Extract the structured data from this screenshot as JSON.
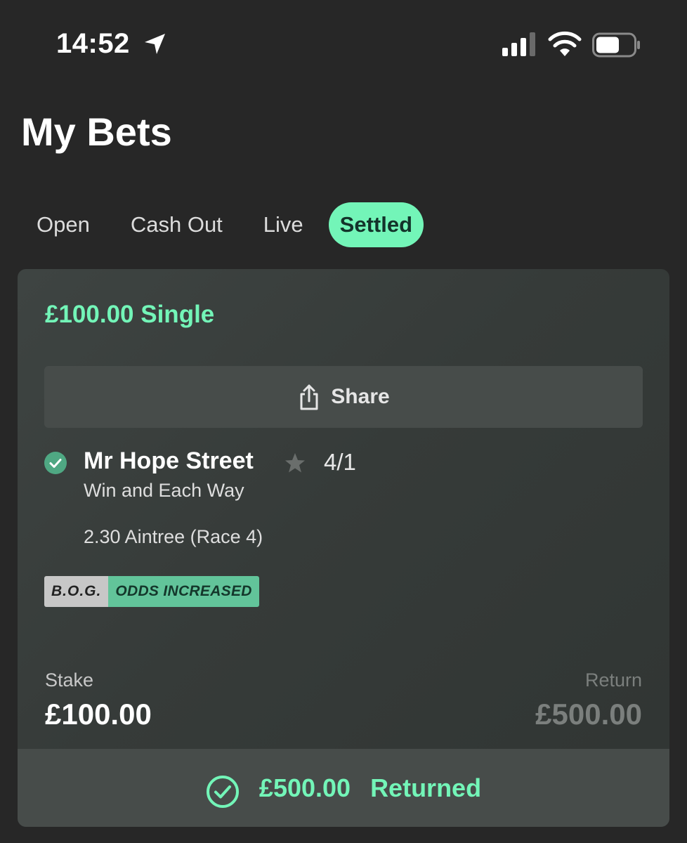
{
  "status_bar": {
    "time": "14:52",
    "icons": [
      "location-arrow-icon",
      "signal-icon",
      "wifi-icon",
      "battery-icon"
    ]
  },
  "page": {
    "title": "My Bets"
  },
  "tabs": [
    {
      "label": "Open",
      "active": false
    },
    {
      "label": "Cash Out",
      "active": false
    },
    {
      "label": "Live",
      "active": false
    },
    {
      "label": "Settled",
      "active": true
    }
  ],
  "bet": {
    "title": "£100.00 Single",
    "share_label": "Share",
    "selection": "Mr Hope Street",
    "odds": "4/1",
    "market": "Win and Each Way",
    "event": "2.30 Aintree (Race 4)",
    "badge": {
      "left": "B.O.G.",
      "right": "ODDS INCREASED"
    },
    "stake_label": "Stake",
    "stake_value": "£100.00",
    "return_label": "Return",
    "return_value": "£500.00",
    "returned_amount": "£500.00",
    "returned_label": "Returned"
  },
  "colors": {
    "accent": "#73f5b8",
    "background": "#272727",
    "card": "#3a3f3d",
    "muted": "#7b7f7d",
    "check": "#4fa883"
  }
}
